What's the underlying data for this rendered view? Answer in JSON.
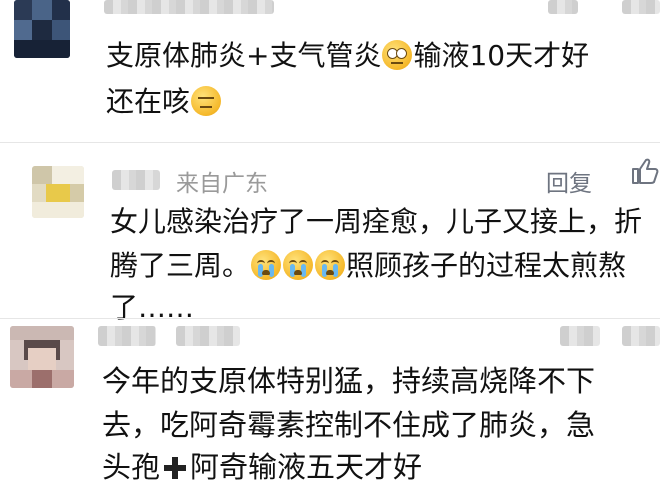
{
  "comments": [
    {
      "lines": [
        "支原体肺炎+支气管炎",
        "输液10天才好",
        "还在咳"
      ],
      "emojis": [
        "eye-roll-emoji",
        "expressionless-emoji"
      ]
    },
    {
      "location": "来自广东",
      "reply_label": "回复",
      "lines": [
        "女儿感染治疗了一周痊愈，儿子又接上，折",
        "腾了三周。",
        "照顾孩子的过程太煎熬",
        "了……"
      ],
      "emojis": [
        "crying-emoji",
        "crying-emoji",
        "crying-emoji"
      ]
    },
    {
      "lines": [
        "今年的支原体特别猛，持续高烧降不下",
        "去，吃阿奇霉素控制不住成了肺炎，急",
        "头孢",
        "阿奇输液五天才好"
      ],
      "icons": [
        "heavy-plus-icon"
      ]
    }
  ],
  "icons": [
    "thumbs-up-icon"
  ],
  "colors": {
    "meta_gray": "#9a9a9a",
    "divider": "#e6e6e6",
    "text": "#111111"
  }
}
